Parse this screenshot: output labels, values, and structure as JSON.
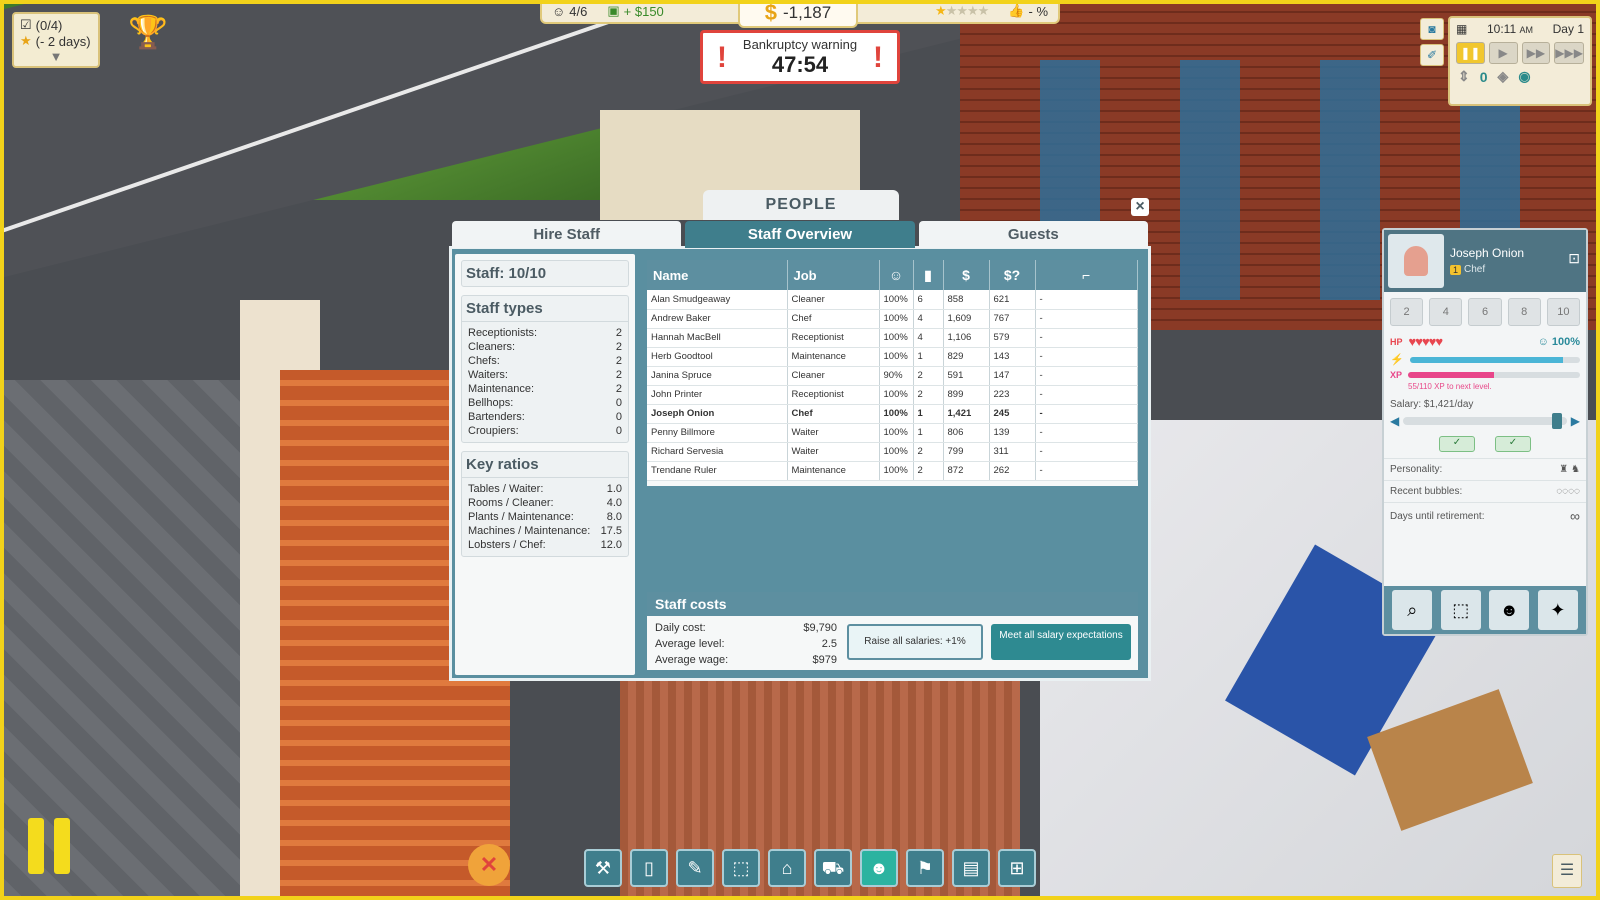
{
  "hud": {
    "guests": "4/6",
    "income": "+ $150",
    "money": "-1,187",
    "rating_stars": 1,
    "rating_max": 5,
    "satisfaction": "- %"
  },
  "bankruptcy": {
    "title": "Bankruptcy warning",
    "timer": "47:54"
  },
  "quests": {
    "count": "(0/4)",
    "days": "(- 2 days)"
  },
  "time": {
    "clock": "10:11",
    "ampm": "AM",
    "day": "Day 1",
    "floor": "0"
  },
  "dialog": {
    "title": "PEOPLE",
    "close": "×",
    "tabs": [
      {
        "label": "Hire Staff",
        "active": false
      },
      {
        "label": "Staff Overview",
        "active": true
      },
      {
        "label": "Guests",
        "active": false
      }
    ]
  },
  "staff_count": "Staff: 10/10",
  "staff_types": {
    "title": "Staff types",
    "items": [
      {
        "label": "Receptionists:",
        "value": "2"
      },
      {
        "label": "Cleaners:",
        "value": "2"
      },
      {
        "label": "Chefs:",
        "value": "2"
      },
      {
        "label": "Waiters:",
        "value": "2"
      },
      {
        "label": "Maintenance:",
        "value": "2"
      },
      {
        "label": "Bellhops:",
        "value": "0"
      },
      {
        "label": "Bartenders:",
        "value": "0"
      },
      {
        "label": "Croupiers:",
        "value": "0"
      }
    ]
  },
  "key_ratios": {
    "title": "Key ratios",
    "items": [
      {
        "label": "Tables / Waiter:",
        "value": "1.0"
      },
      {
        "label": "Rooms / Cleaner:",
        "value": "4.0"
      },
      {
        "label": "Plants / Maintenance:",
        "value": "8.0"
      },
      {
        "label": "Machines / Maintenance:",
        "value": "17.5"
      },
      {
        "label": "Lobsters / Chef:",
        "value": "12.0"
      }
    ]
  },
  "table": {
    "headers": {
      "name": "Name",
      "job": "Job",
      "happy": "☺",
      "level": "▮",
      "wage": "$",
      "expect": "$?",
      "extra": "⌐"
    },
    "rows": [
      [
        "Alan Smudgeaway",
        "Cleaner",
        "100%",
        "6",
        "858",
        "621",
        "-"
      ],
      [
        "Andrew Baker",
        "Chef",
        "100%",
        "4",
        "1,609",
        "767",
        "-"
      ],
      [
        "Hannah MacBell",
        "Receptionist",
        "100%",
        "4",
        "1,106",
        "579",
        "-"
      ],
      [
        "Herb Goodtool",
        "Maintenance",
        "100%",
        "1",
        "829",
        "143",
        "-"
      ],
      [
        "Janina Spruce",
        "Cleaner",
        "90%",
        "2",
        "591",
        "147",
        "-"
      ],
      [
        "John Printer",
        "Receptionist",
        "100%",
        "2",
        "899",
        "223",
        "-"
      ],
      [
        "Joseph Onion",
        "Chef",
        "100%",
        "1",
        "1,421",
        "245",
        "-"
      ],
      [
        "Penny Billmore",
        "Waiter",
        "100%",
        "1",
        "806",
        "139",
        "-"
      ],
      [
        "Richard Servesia",
        "Waiter",
        "100%",
        "2",
        "799",
        "311",
        "-"
      ],
      [
        "Trendane Ruler",
        "Maintenance",
        "100%",
        "2",
        "872",
        "262",
        "-"
      ]
    ],
    "selected_index": 6
  },
  "costs": {
    "title": "Staff costs",
    "items": [
      {
        "label": "Daily cost:",
        "value": "$9,790"
      },
      {
        "label": "Average level:",
        "value": "2.5"
      },
      {
        "label": "Average wage:",
        "value": "$979"
      }
    ],
    "raise_button": "Raise all salaries: +1%",
    "meet_button": "Meet all salary expectations"
  },
  "inspector": {
    "name": "Joseph Onion",
    "level_badge": "1",
    "job": "Chef",
    "levels": [
      "2",
      "4",
      "6",
      "8",
      "10"
    ],
    "hp_hearts": 5,
    "happiness": "100%",
    "energy_fraction": 0.9,
    "xp_fraction": 0.5,
    "xp_text": "55/110 XP to next level.",
    "salary_label": "Salary: $1,421/day",
    "salary_fraction": 0.97,
    "personality_label": "Personality:",
    "bubbles_label": "Recent bubbles:",
    "retirement_label": "Days until retirement:",
    "retirement_value": "∞",
    "colors": {
      "hp": "#e8464f",
      "energy": "#4ab5d6",
      "xp": "#e8468a"
    }
  },
  "toolbar": {
    "tools": [
      {
        "icon": "hammer-icon",
        "glyph": "⚒"
      },
      {
        "icon": "door-icon",
        "glyph": "▯"
      },
      {
        "icon": "paintbrush-icon",
        "glyph": "✎"
      },
      {
        "icon": "zone-icon",
        "glyph": "⬚"
      },
      {
        "icon": "furniture-icon",
        "glyph": "⌂"
      },
      {
        "icon": "bulldozer-icon",
        "glyph": "⛟"
      },
      {
        "icon": "people-icon",
        "glyph": "☻"
      },
      {
        "icon": "education-icon",
        "glyph": "⚑"
      },
      {
        "icon": "report-icon",
        "glyph": "▤"
      },
      {
        "icon": "hierarchy-icon",
        "glyph": "⊞"
      }
    ],
    "active_index": 6
  }
}
